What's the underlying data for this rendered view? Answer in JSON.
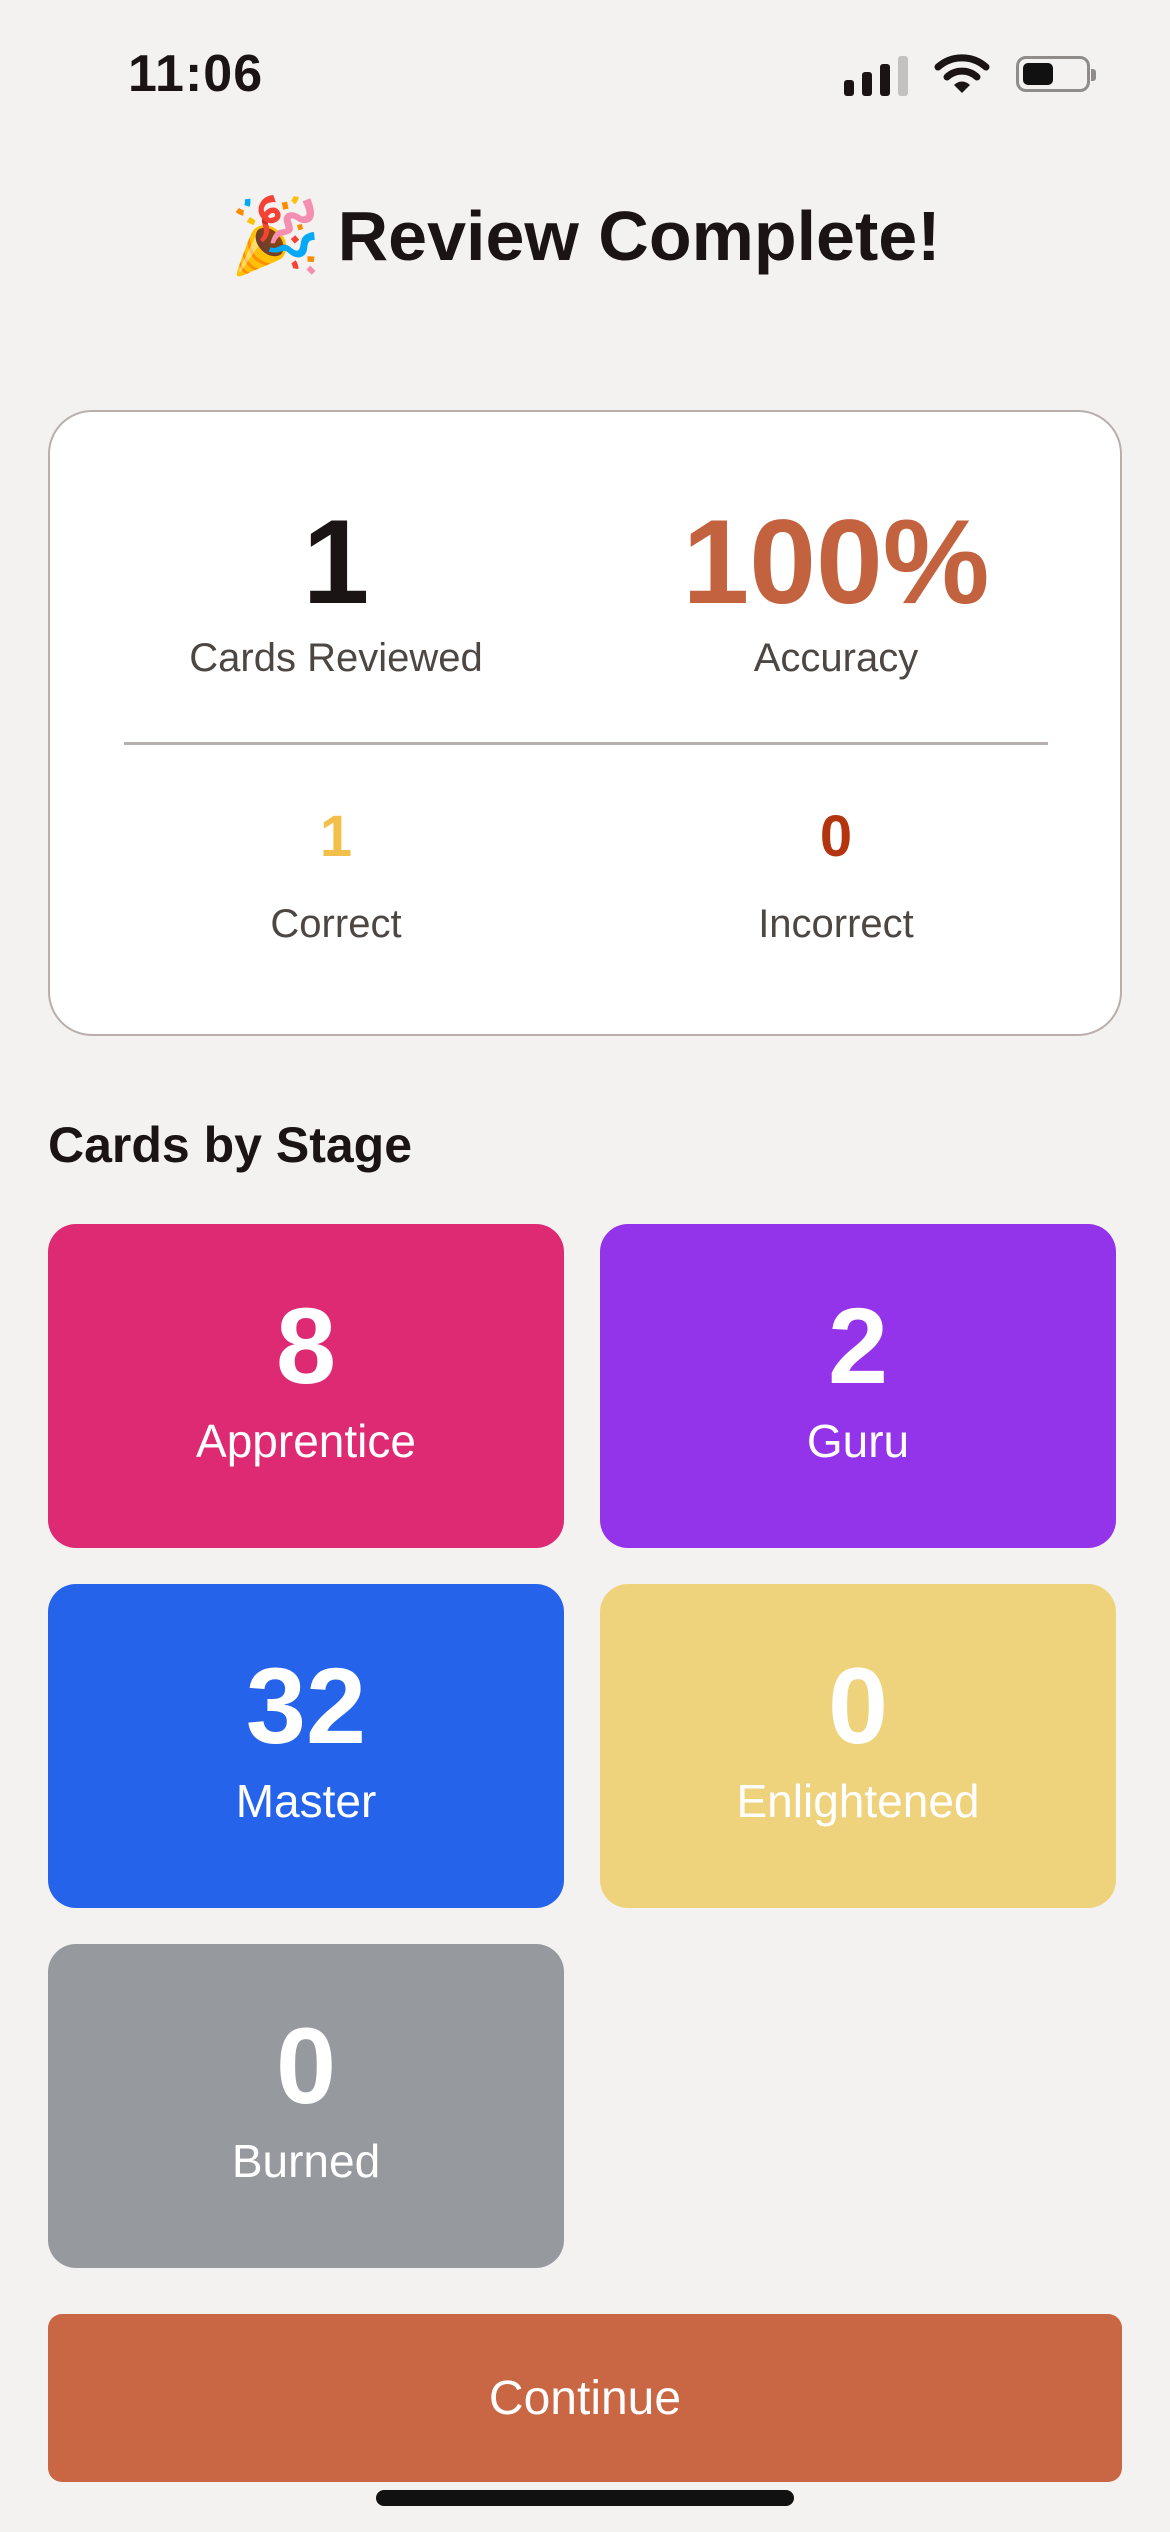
{
  "status_bar": {
    "time": "11:06",
    "icons": [
      "signal-icon",
      "wifi-icon",
      "battery-icon"
    ],
    "battery_level": 0.5
  },
  "header": {
    "title": "Review Complete!",
    "icon": "party-popper-icon",
    "emoji": "🎉"
  },
  "summary": {
    "cards_reviewed": {
      "value": "1",
      "label": "Cards Reviewed",
      "color": "#1a1414"
    },
    "accuracy": {
      "value": "100%",
      "label": "Accuracy",
      "color": "#c2623f"
    },
    "correct": {
      "value": "1",
      "label": "Correct",
      "color": "#f2c04a"
    },
    "incorrect": {
      "value": "0",
      "label": "Incorrect",
      "color": "#b3340f"
    }
  },
  "stages": {
    "title": "Cards by Stage",
    "items": [
      {
        "count": "8",
        "label": "Apprentice",
        "color": "#dd2a72"
      },
      {
        "count": "2",
        "label": "Guru",
        "color": "#9333ea"
      },
      {
        "count": "32",
        "label": "Master",
        "color": "#2563eb"
      },
      {
        "count": "0",
        "label": "Enlightened",
        "color": "#efd27c"
      },
      {
        "count": "0",
        "label": "Burned",
        "color": "#969a9f"
      }
    ]
  },
  "actions": {
    "continue_label": "Continue",
    "continue_color": "#c96643"
  }
}
